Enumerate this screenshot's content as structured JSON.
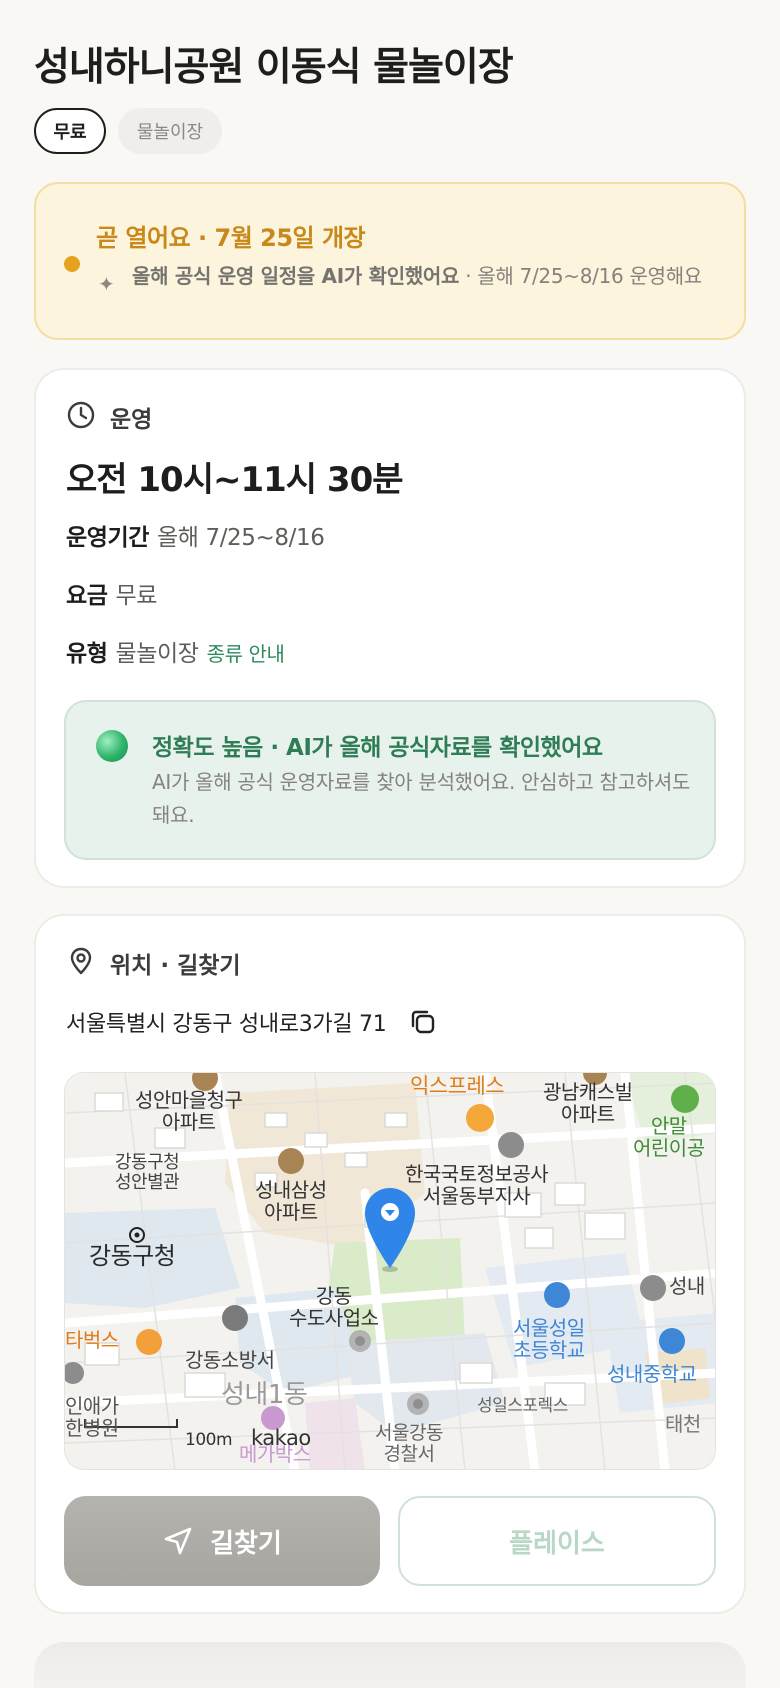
{
  "header": {
    "title": "성내하니공원 이동식 물놀이장"
  },
  "chips": {
    "fee": "무료",
    "type": "물놀이장"
  },
  "notice": {
    "title": "곧 열어요 · 7월 25일 개장",
    "body_bold": "올해 공식 운영 일정을 AI가 확인했어요",
    "body_rest": " · 올해 7/25~8/16 운영해요",
    "colors": {
      "accent": "#e5a21f",
      "background": "#fdf4de"
    }
  },
  "operation": {
    "section_label": "운영",
    "hours": "오전 10시~11시 30분",
    "period_key": "운영기간",
    "period_value": "올해 7/25~8/16",
    "fee_key": "요금",
    "fee_value": "무료",
    "type_key": "유형",
    "type_value": "물놀이장",
    "type_link": "종류 안내",
    "accuracy": {
      "title": "정확도 높음 · AI가 올해 공식자료를 확인했어요",
      "body": "AI가 올해 공식 운영자료를 찾아 분석했어요. 안심하고 참고하셔도 돼요."
    }
  },
  "location": {
    "section_label": "위치 · 길찾기",
    "address": "서울특별시 강동구 성내로3가길 71",
    "map": {
      "labels": {
        "express": "익스프레스",
        "gwangnam": "광남캐스빌\n아파트",
        "anmal": "안말\n어린이공",
        "seongan": "성안마을청구\n아파트",
        "gangdong_annex": "강동구청\n성안별관",
        "gangdong_office": "강동구청",
        "seongnae_samsung": "성내삼성\n아파트",
        "land_info": "한국국토정보공사\n서울동부지사",
        "waterworks": "강동\n수도사업소",
        "starbucks": "타벅스",
        "fire_station": "강동소방서",
        "seongnae1dong": "성내1동",
        "inae": "인애가\n한병원",
        "seoul_seongil": "서울성일\n초등학교",
        "seongnae_middle": "성내중학교",
        "seongnae_right": "성내",
        "seongil_express": "성일스포렉스",
        "police": "서울강동\n경찰서",
        "megabox": "메가박스",
        "taecheon": "태천",
        "scale": "100m",
        "brand": "kakao"
      },
      "colors": {
        "pin": "#2f86e8",
        "park": "#d9ebc9",
        "water_area": "#dfe7ef"
      }
    },
    "buttons": {
      "navigate": "길찾기",
      "place": "플레이스"
    }
  }
}
